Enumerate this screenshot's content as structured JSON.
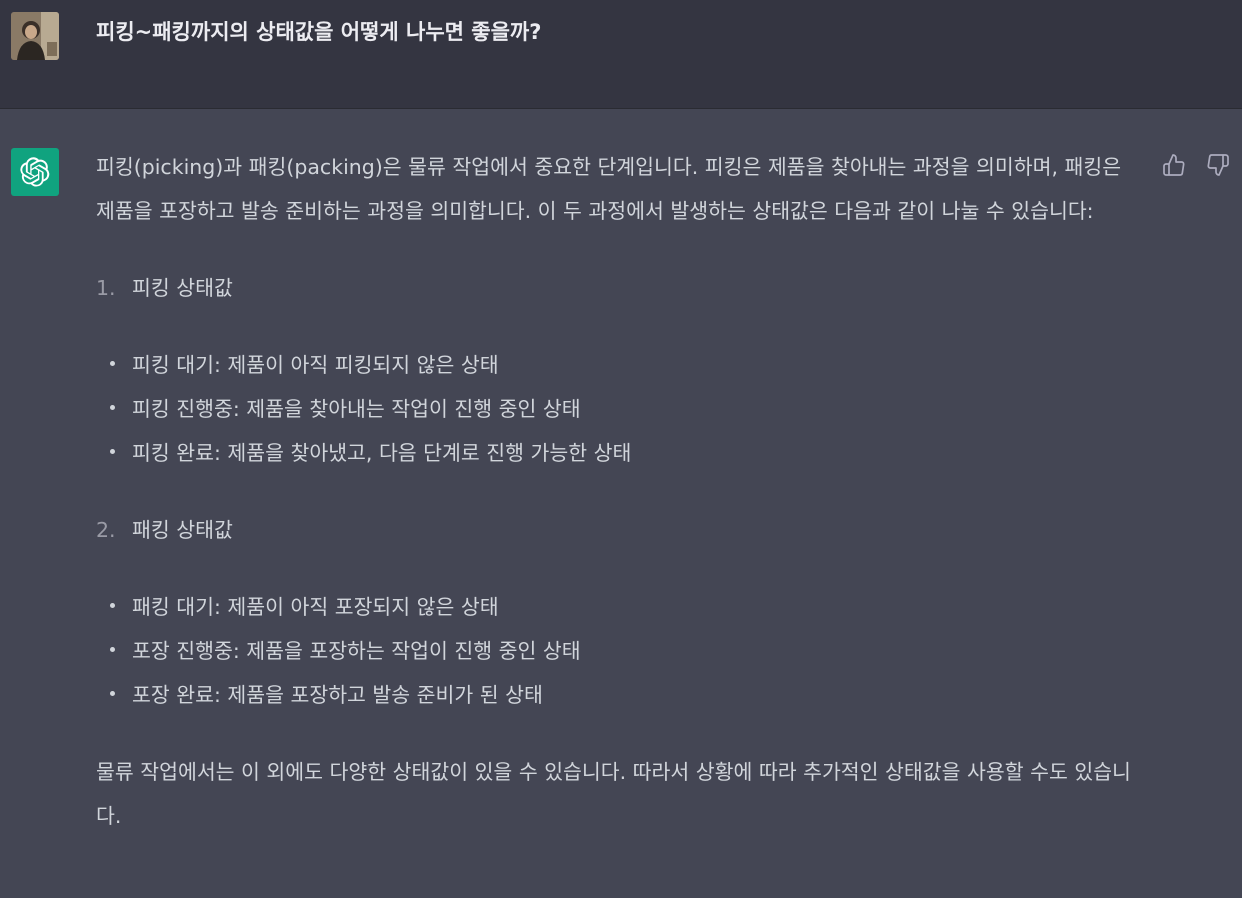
{
  "user": {
    "message": "피킹~패킹까지의 상태값을 어떻게 나누면 좋을까?"
  },
  "assistant": {
    "intro": "피킹(picking)과 패킹(packing)은 물류 작업에서 중요한 단계입니다. 피킹은 제품을 찾아내는 과정을 의미하며, 패킹은 제품을 포장하고 발송 준비하는 과정을 의미합니다. 이 두 과정에서 발생하는 상태값은 다음과 같이 나눌 수 있습니다:",
    "sections": [
      {
        "number": "1.",
        "title": "피킹 상태값",
        "items": [
          "피킹 대기: 제품이 아직 피킹되지 않은 상태",
          "피킹 진행중: 제품을 찾아내는 작업이 진행 중인 상태",
          "피킹 완료: 제품을 찾아냈고, 다음 단계로 진행 가능한 상태"
        ]
      },
      {
        "number": "2.",
        "title": "패킹 상태값",
        "items": [
          "패킹 대기: 제품이 아직 포장되지 않은 상태",
          "포장 진행중: 제품을 포장하는 작업이 진행 중인 상태",
          "포장 완료: 제품을 포장하고 발송 준비가 된 상태"
        ]
      }
    ],
    "outro": "물류 작업에서는 이 외에도 다양한 상태값이 있을 수 있습니다. 따라서 상황에 따라 추가적인 상태값을 사용할 수도 있습니다."
  },
  "icons": {
    "avatar": "user-avatar-photo",
    "logo": "openai-logo-icon",
    "thumbs_up": "thumbs-up-icon",
    "thumbs_down": "thumbs-down-icon"
  },
  "colors": {
    "user_bg": "#343541",
    "assistant_bg": "#444654",
    "logo_bg": "#10a37f",
    "text": "#d1d5db"
  }
}
